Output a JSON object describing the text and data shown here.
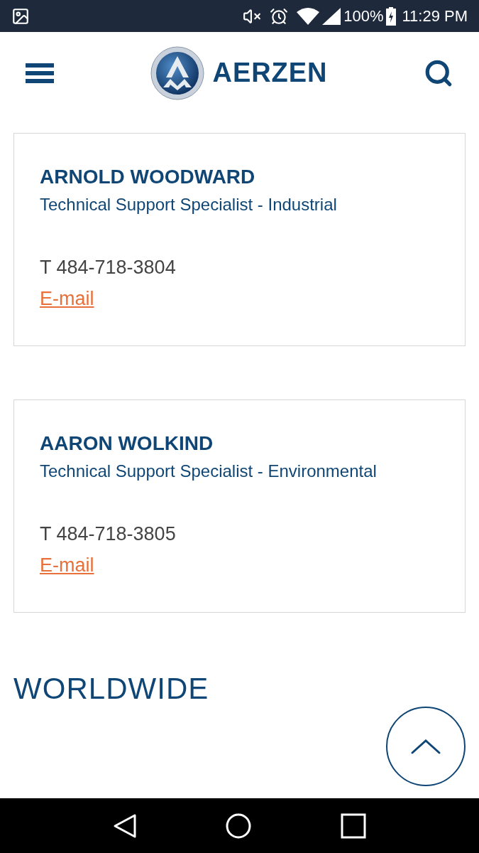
{
  "status_bar": {
    "battery": "100%",
    "time": "11:29 PM"
  },
  "header": {
    "logo_text": "AERZEN"
  },
  "contacts": [
    {
      "name": "ARNOLD WOODWARD",
      "role": "Technical Support Specialist - Industrial",
      "phone": "T 484-718-3804",
      "email_label": "E-mail"
    },
    {
      "name": "AARON WOLKIND",
      "role": "Technical Support Specialist - Environmental",
      "phone": "T 484-718-3805",
      "email_label": "E-mail"
    }
  ],
  "section": {
    "heading": "WORLDWIDE"
  }
}
